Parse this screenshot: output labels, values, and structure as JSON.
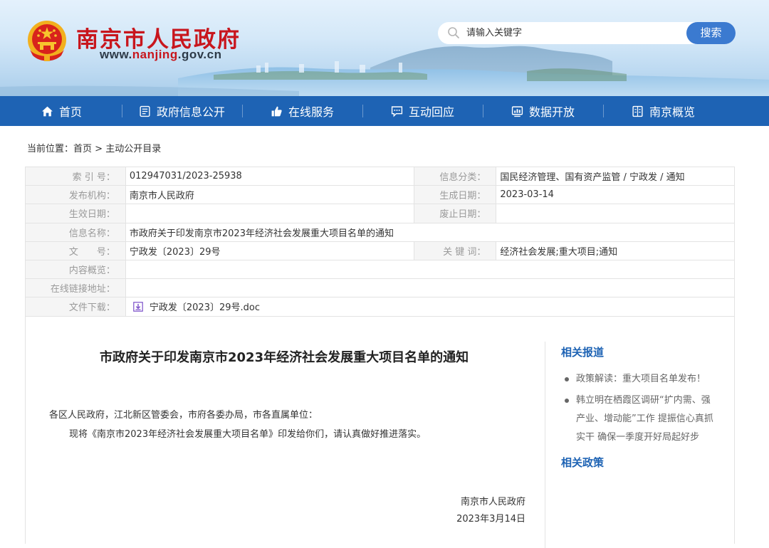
{
  "header": {
    "site_title": "南京市人民政府",
    "url_prefix": "www.",
    "url_mid": "nanjing",
    "url_suffix": ".gov.cn",
    "search_placeholder": "请输入关键字",
    "search_button": "搜索"
  },
  "nav": {
    "items": [
      {
        "label": "首页",
        "icon": "home-icon"
      },
      {
        "label": "政府信息公开",
        "icon": "document-icon"
      },
      {
        "label": "在线服务",
        "icon": "thumbs-up-icon"
      },
      {
        "label": "互动回应",
        "icon": "chat-icon"
      },
      {
        "label": "数据开放",
        "icon": "data-chart-icon"
      },
      {
        "label": "南京概览",
        "icon": "overview-icon"
      }
    ]
  },
  "breadcrumb": {
    "prefix": "当前位置：",
    "home": "首页",
    "separator": " > ",
    "current": "主动公开目录"
  },
  "info": {
    "index_label": "索 引 号：",
    "index_value": "012947031/2023-25938",
    "category_label": "信息分类：",
    "category_value": "国民经济管理、国有资产监管 / 宁政发 / 通知",
    "publisher_label": "发布机构：",
    "publisher_value": "南京市人民政府",
    "created_label": "生成日期：",
    "created_value": "2023-03-14",
    "effective_label": "生效日期：",
    "effective_value": "",
    "expire_label": "废止日期：",
    "expire_value": "",
    "name_label": "信息名称：",
    "name_value": "市政府关于印发南京市2023年经济社会发展重大项目名单的通知",
    "docno_label": "文　　号：",
    "docno_value": "宁政发〔2023〕29号",
    "keywords_label": "关 键 词：",
    "keywords_value": "经济社会发展;重大项目;通知",
    "summary_label": "内容概览：",
    "summary_value": "",
    "link_label": "在线链接地址：",
    "link_value": "",
    "download_label": "文件下载：",
    "download_value": "宁政发〔2023〕29号.doc"
  },
  "document": {
    "title": "市政府关于印发南京市2023年经济社会发展重大项目名单的通知",
    "addressee": "各区人民政府，江北新区管委会，市府各委办局，市各直属单位：",
    "body": "现将《南京市2023年经济社会发展重大项目名单》印发给你们，请认真做好推进落实。",
    "signature": "南京市人民政府",
    "date": "2023年3月14日"
  },
  "sidebar": {
    "related_reports_title": "相关报道",
    "related_reports": [
      "政策解读：重大项目名单发布！",
      "韩立明在栖霞区调研“扩内需、强产业、增动能”工作 提振信心真抓实干 确保一季度开好局起好步"
    ],
    "related_policies_title": "相关政策"
  },
  "colors": {
    "brand_red": "#c8161d",
    "nav_blue": "#1e63b4",
    "search_button_blue": "#3b7ad0",
    "label_gray": "#9a9a9a"
  }
}
